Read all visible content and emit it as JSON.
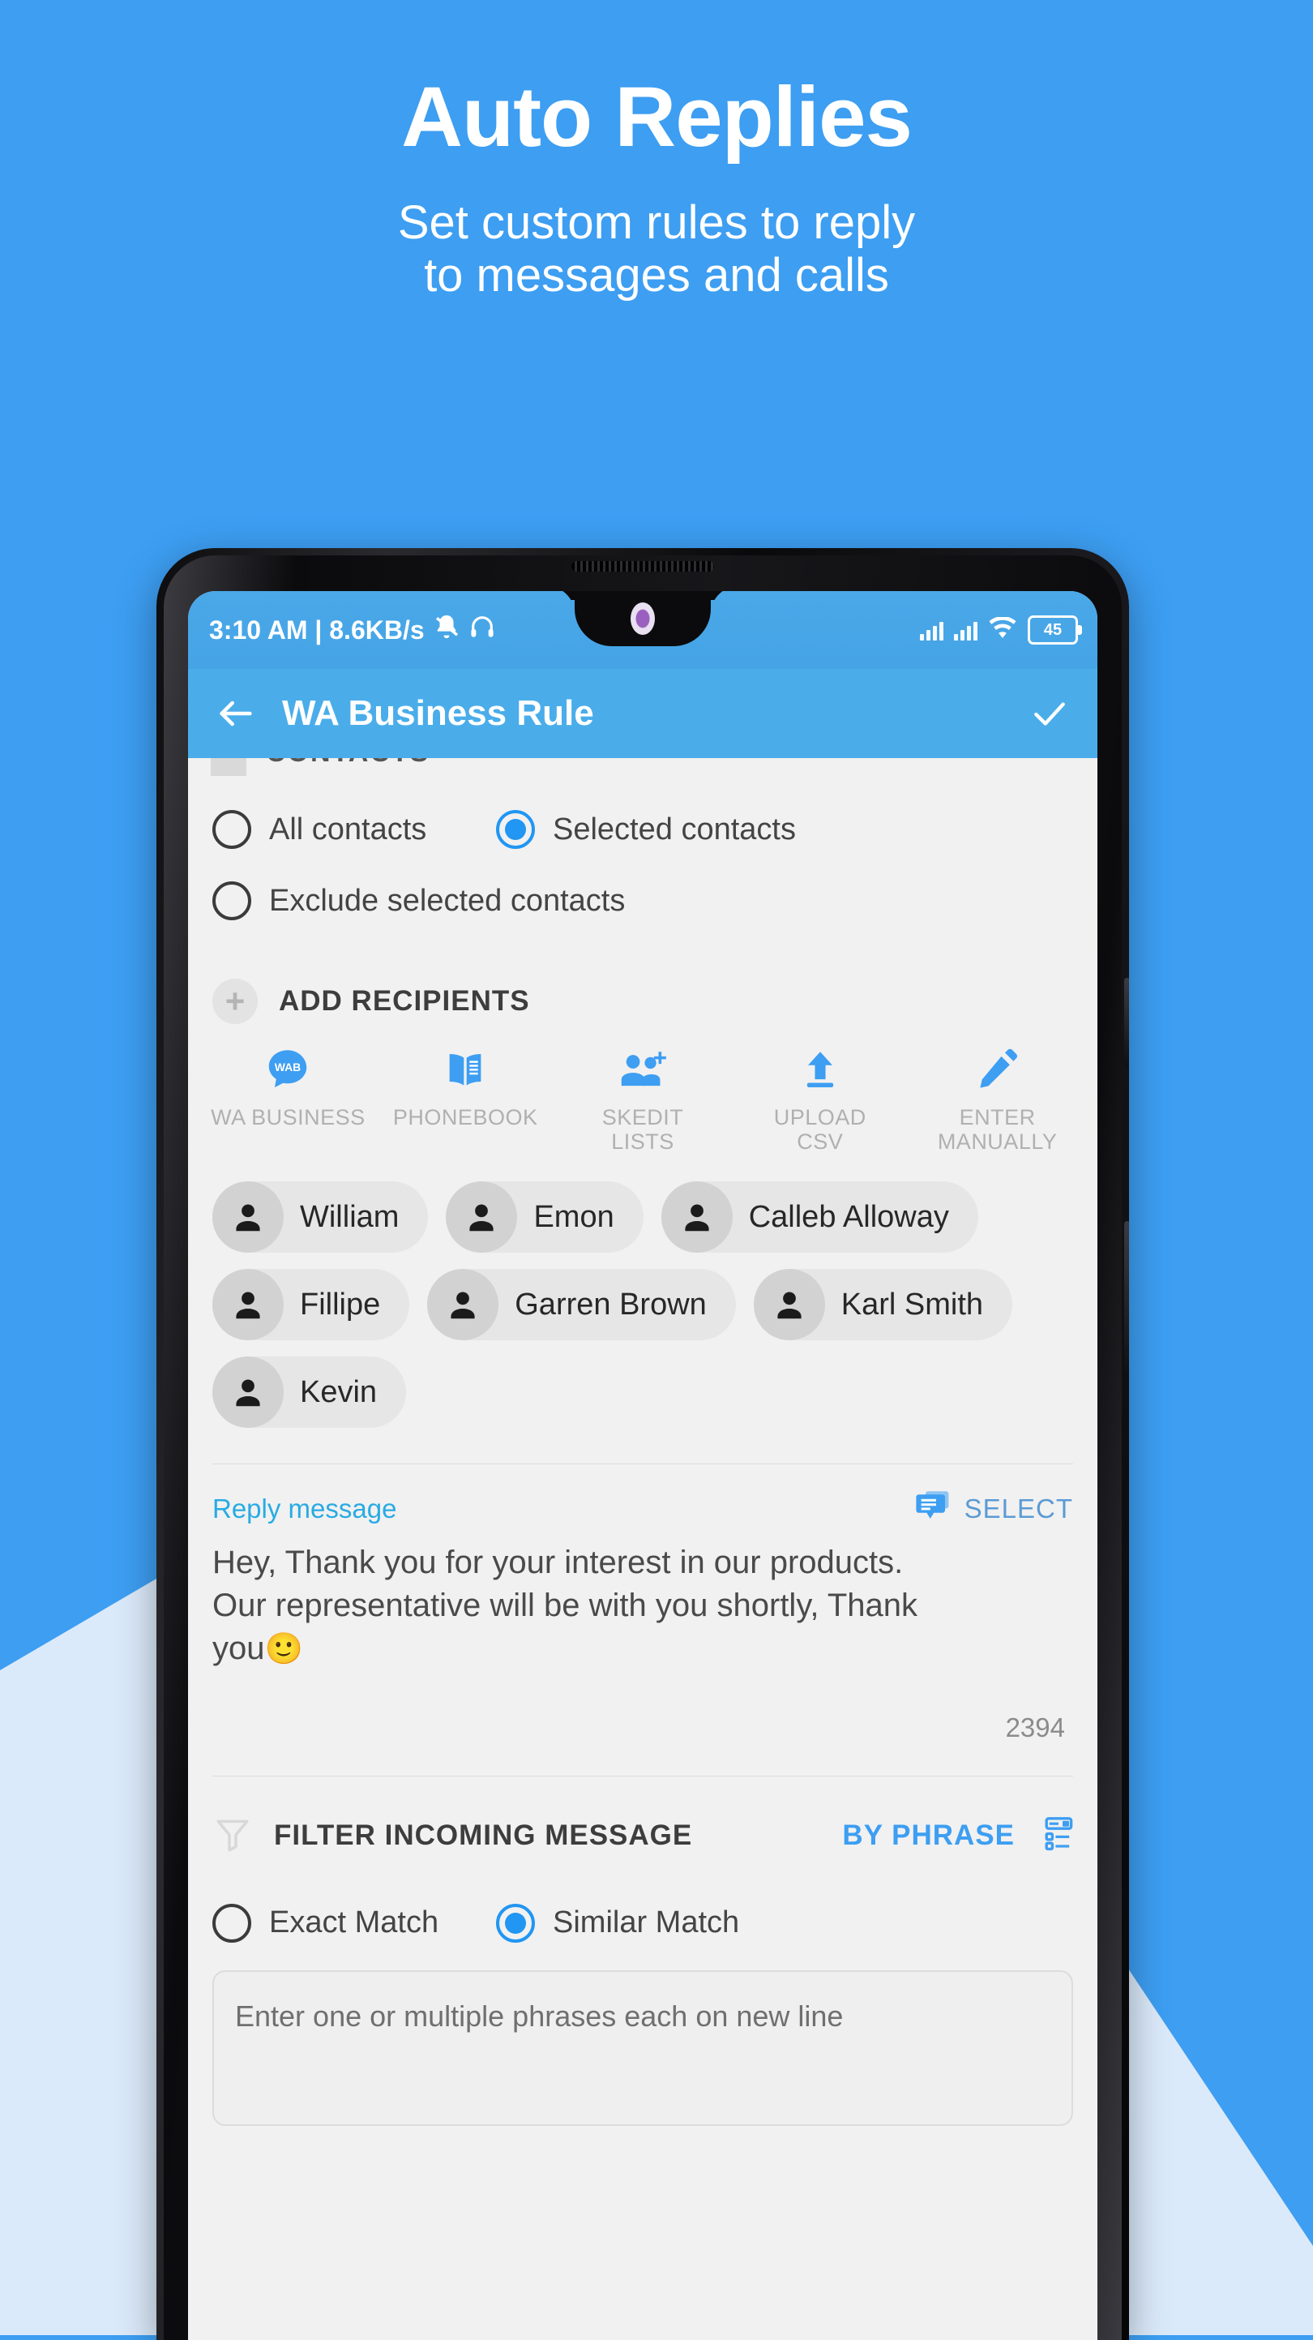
{
  "promo": {
    "title": "Auto Replies",
    "subtitle_line1": "Set custom rules to reply",
    "subtitle_line2": "to messages and calls"
  },
  "colors": {
    "background_blue": "#3d9ef2",
    "wedge_light_blue": "#dbeafb",
    "appbar_blue": "#4aadea",
    "statusbar_blue": "#45a4e6",
    "accent_blue": "#2196f3",
    "link_cyan": "#29abe2",
    "screen_bg": "#f1f1f1"
  },
  "status_bar": {
    "time_and_speed": "3:10 AM | 8.6KB/s",
    "mute_icon": "bell-muted-icon",
    "headphone_icon": "headphones-icon",
    "signal_icon_1": "signal-bars-icon",
    "signal_icon_2": "signal-bars-icon",
    "wifi_icon": "wifi-icon",
    "battery_level": "45"
  },
  "app_bar": {
    "back_icon": "arrow-back-icon",
    "title": "WA Business Rule",
    "confirm_icon": "check-icon"
  },
  "contacts_section": {
    "clipped_header": "CONTACTS",
    "options": [
      {
        "label": "All contacts",
        "selected": false
      },
      {
        "label": "Selected contacts",
        "selected": true
      },
      {
        "label": "Exclude selected contacts",
        "selected": false
      }
    ]
  },
  "add_recipients": {
    "plus_icon": "plus-icon",
    "header": "ADD RECIPIENTS",
    "sources": [
      {
        "label_line1": "WA BUSINESS",
        "label_line2": "",
        "icon": "wa-business-bubble-icon",
        "badge": "WAB"
      },
      {
        "label_line1": "PHONEBOOK",
        "label_line2": "",
        "icon": "phonebook-icon"
      },
      {
        "label_line1": "SKEDIT",
        "label_line2": "LISTS",
        "icon": "people-add-icon"
      },
      {
        "label_line1": "UPLOAD",
        "label_line2": "CSV",
        "icon": "upload-icon"
      },
      {
        "label_line1": "ENTER",
        "label_line2": "MANUALLY",
        "icon": "pencil-icon"
      }
    ]
  },
  "recipients": [
    {
      "name": "William"
    },
    {
      "name": "Emon"
    },
    {
      "name": "Calleb Alloway"
    },
    {
      "name": "Fillipe"
    },
    {
      "name": "Garren Brown"
    },
    {
      "name": "Karl Smith"
    },
    {
      "name": "Kevin"
    }
  ],
  "reply_message": {
    "label": "Reply message",
    "select_label": "SELECT",
    "select_icon": "message-template-icon",
    "text_line1": "Hey, Thank you for your interest in our products.",
    "text_line2": "Our representative will be with you shortly, Thank",
    "text_line3": "you",
    "emoji": "🙂",
    "char_count": "2394"
  },
  "filter_section": {
    "filter_icon": "funnel-icon",
    "label": "FILTER INCOMING MESSAGE",
    "mode_label": "BY PHRASE",
    "mode_icon": "list-settings-icon",
    "match_options": [
      {
        "label": "Exact Match",
        "selected": false
      },
      {
        "label": "Similar Match",
        "selected": true
      }
    ],
    "phrase_placeholder": "Enter one or multiple phrases each on new line"
  }
}
